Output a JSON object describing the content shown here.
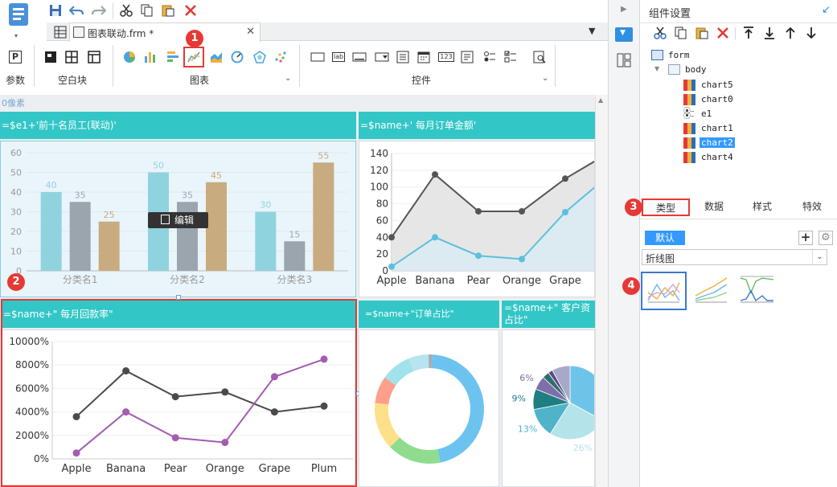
{
  "app": {
    "colors": {
      "accent": "#33c6c6",
      "marker": "#e53935"
    }
  },
  "doc_tab": {
    "title": "图表联动.frm *"
  },
  "ribbon": {
    "groups": {
      "param": "参数",
      "blank": "空白块",
      "chart": "图表",
      "control": "控件"
    },
    "param_icon": "P",
    "control_text_icon": "lab",
    "control_num_icon": "123"
  },
  "canvas": {
    "ruler_label": "0像素"
  },
  "widgets": {
    "chart_e1": {
      "header": "=$e1+'前十名员工(联动)'",
      "edit_label": "编辑"
    },
    "chart_order": {
      "header": "=$name+' 每月订单金额'"
    },
    "chart_payment": {
      "header": "=$name+\" 每月回款率\""
    },
    "chart_share": {
      "header": "=$name+\"订单占比\""
    },
    "chart_customer": {
      "header_line1": "=$name+\" 客户资",
      "header_line2": "占比\""
    }
  },
  "markers": [
    "1",
    "2",
    "3",
    "4"
  ],
  "right_panel": {
    "title": "组件设置",
    "tree": {
      "form": "form",
      "body": "body",
      "items": [
        "chart5",
        "chart0",
        "e1",
        "chart1",
        "chart2",
        "chart4"
      ],
      "selected": "chart2"
    },
    "tabs": [
      "类型",
      "数据",
      "样式",
      "特效"
    ],
    "default_label": "默认",
    "chart_type": "折线图"
  },
  "chart_data": [
    {
      "type": "bar",
      "categories": [
        "分类名1",
        "分类名2",
        "分类名3"
      ],
      "series": [
        {
          "values": [
            40,
            50,
            30
          ]
        },
        {
          "values": [
            35,
            35,
            15
          ]
        },
        {
          "values": [
            25,
            45,
            55
          ]
        }
      ],
      "data_labels": [
        [
          "40",
          "35",
          "25"
        ],
        [
          "50",
          "35",
          "45"
        ],
        [
          "30",
          "15",
          "55"
        ]
      ],
      "yticks": [
        "0",
        "10",
        "20",
        "30",
        "40",
        "50",
        "60"
      ],
      "ylim": [
        0,
        60
      ],
      "colors": [
        "#8fd3de",
        "#9aa5ad",
        "#c8ab7e"
      ]
    },
    {
      "type": "area",
      "categories": [
        "Apple",
        "Banana",
        "Pear",
        "Orange",
        "Grape"
      ],
      "series": [
        {
          "values": [
            40,
            115,
            71,
            71,
            110
          ],
          "color": "#555555"
        },
        {
          "values": [
            5,
            40,
            18,
            14,
            70
          ],
          "color": "#5bc0de"
        }
      ],
      "yticks": [
        "0",
        "20",
        "40",
        "60",
        "80",
        "100",
        "120",
        "140"
      ],
      "ylim": [
        0,
        140
      ]
    },
    {
      "type": "line",
      "categories": [
        "Apple",
        "Banana",
        "Pear",
        "Orange",
        "Grape",
        "Plum"
      ],
      "series": [
        {
          "values": [
            3600,
            7500,
            5300,
            5700,
            4000,
            4500
          ],
          "color": "#4a4a4a"
        },
        {
          "values": [
            500,
            4000,
            1800,
            1400,
            7000,
            8500
          ],
          "color": "#a25cb0"
        }
      ],
      "yticks": [
        "0%",
        "2000%",
        "4000%",
        "6000%",
        "8000%",
        "10000%"
      ],
      "ylim": [
        0,
        10000
      ]
    },
    {
      "type": "pie",
      "variant": "donut",
      "values": [
        46,
        16,
        14,
        8,
        9,
        6,
        1
      ],
      "colors": [
        "#6cc3f0",
        "#8fdc8f",
        "#ffe08a",
        "#ff9e8a",
        "#a0e3ec",
        "#b7e4ee",
        "#aaaaaa"
      ]
    },
    {
      "type": "pie",
      "values": [
        33,
        26,
        13,
        9,
        6,
        3,
        2,
        8
      ],
      "labels": [
        "",
        "26%",
        "13%",
        "9%",
        "6%",
        "",
        "",
        ""
      ],
      "colors": [
        "#6ec4e8",
        "#b5e3ea",
        "#4fb3c9",
        "#1f7f80",
        "#7e6eaa",
        "#2d6f6f",
        "#5a4a82",
        "#a8a8c8"
      ]
    }
  ]
}
